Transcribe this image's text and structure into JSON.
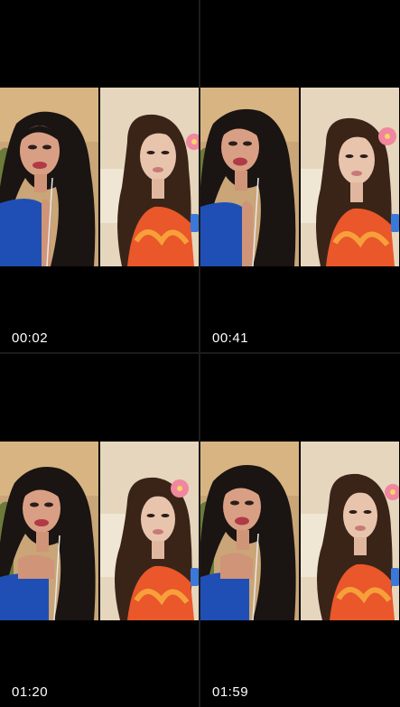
{
  "recordings": [
    {
      "timestamp": "00:02"
    },
    {
      "timestamp": "00:41"
    },
    {
      "timestamp": "01:20"
    },
    {
      "timestamp": "01:59"
    }
  ],
  "colors": {
    "background": "#000000",
    "divider": "#1c1c1e",
    "text": "#ffffff"
  }
}
